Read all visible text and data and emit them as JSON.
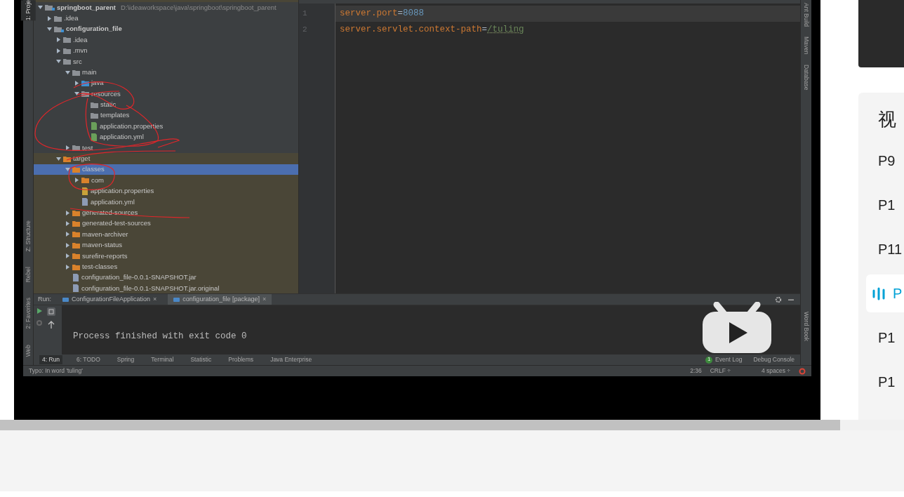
{
  "ide": {
    "left_tools": [
      {
        "label": "1: Proje",
        "selected": true
      },
      {
        "label": "Z: Structure",
        "selected": false
      },
      {
        "label": "Rebel",
        "selected": false
      },
      {
        "label": "2: Favorites",
        "selected": false
      },
      {
        "label": "Web",
        "selected": false
      }
    ],
    "right_tools": [
      {
        "label": "Ant Build"
      },
      {
        "label": "Maven"
      },
      {
        "label": "Database"
      }
    ],
    "right_tools_bottom": [
      {
        "label": "Word Book"
      }
    ],
    "tree": [
      {
        "label": "springboot_parent",
        "hint": "D:\\ideaworkspace\\java\\springboot\\springboot_parent",
        "kind": "folder",
        "module": true,
        "expanded": true,
        "selected": false,
        "color": "#8d9196",
        "children": [
          {
            "label": ".idea",
            "kind": "folder",
            "expanded": false,
            "selected": false,
            "color": "#8d9196"
          },
          {
            "label": "configuration_file",
            "kind": "folder",
            "module": true,
            "expanded": true,
            "selected": false,
            "color": "#8d9196",
            "children": [
              {
                "label": ".idea",
                "kind": "folder",
                "expanded": false,
                "selected": false,
                "color": "#8d9196"
              },
              {
                "label": ".mvn",
                "kind": "folder",
                "expanded": false,
                "selected": false,
                "color": "#8d9196"
              },
              {
                "label": "src",
                "kind": "folder",
                "expanded": true,
                "selected": false,
                "color": "#8d9196",
                "children": [
                  {
                    "label": "main",
                    "kind": "folder",
                    "expanded": true,
                    "selected": false,
                    "color": "#8d9196",
                    "children": [
                      {
                        "label": "java",
                        "kind": "folder",
                        "expanded": false,
                        "selected": false,
                        "color": "#3d8fd1"
                      },
                      {
                        "label": "resources",
                        "kind": "folder",
                        "expanded": true,
                        "selected": false,
                        "color": "#8d9196",
                        "children": [
                          {
                            "label": "static",
                            "kind": "leaf",
                            "selected": false,
                            "color": "#8d9196"
                          },
                          {
                            "label": "templates",
                            "kind": "leaf",
                            "selected": false,
                            "color": "#8d9196"
                          },
                          {
                            "label": "application.properties",
                            "kind": "file",
                            "selected": false,
                            "color": "#6a9f5a"
                          },
                          {
                            "label": "application.yml",
                            "kind": "file",
                            "selected": false,
                            "color": "#6a9f5a"
                          }
                        ]
                      }
                    ]
                  },
                  {
                    "label": "test",
                    "kind": "folder",
                    "expanded": false,
                    "selected": false,
                    "color": "#8d9196"
                  }
                ]
              },
              {
                "label": "target",
                "kind": "folder",
                "expanded": true,
                "selected": false,
                "excluded": true,
                "color": "#d9822b",
                "children": [
                  {
                    "label": "classes",
                    "kind": "folder",
                    "expanded": true,
                    "selected": true,
                    "color": "#d9822b",
                    "children": [
                      {
                        "label": "com",
                        "kind": "folder",
                        "expanded": false,
                        "selected": false,
                        "color": "#d9822b"
                      },
                      {
                        "label": "application.properties",
                        "kind": "file",
                        "selected": false,
                        "color": "#c9a33a"
                      },
                      {
                        "label": "application.yml",
                        "kind": "file",
                        "selected": false,
                        "color": "#8d9bb5"
                      }
                    ]
                  },
                  {
                    "label": "generated-sources",
                    "kind": "folder",
                    "expanded": false,
                    "selected": false,
                    "color": "#d9822b"
                  },
                  {
                    "label": "generated-test-sources",
                    "kind": "folder",
                    "expanded": false,
                    "selected": false,
                    "color": "#d9822b"
                  },
                  {
                    "label": "maven-archiver",
                    "kind": "folder",
                    "expanded": false,
                    "selected": false,
                    "color": "#d9822b"
                  },
                  {
                    "label": "maven-status",
                    "kind": "folder",
                    "expanded": false,
                    "selected": false,
                    "color": "#d9822b"
                  },
                  {
                    "label": "surefire-reports",
                    "kind": "folder",
                    "expanded": false,
                    "selected": false,
                    "color": "#d9822b"
                  },
                  {
                    "label": "test-classes",
                    "kind": "folder",
                    "expanded": false,
                    "selected": false,
                    "color": "#d9822b"
                  },
                  {
                    "label": "configuration_file-0.0.1-SNAPSHOT.jar",
                    "kind": "file",
                    "selected": false,
                    "color": "#8d9bb5"
                  },
                  {
                    "label": "configuration_file-0.0.1-SNAPSHOT.jar.original",
                    "kind": "file",
                    "selected": false,
                    "color": "#8d9bb5"
                  }
                ]
              }
            ]
          }
        ]
      }
    ],
    "editor": {
      "lines": [
        {
          "number": "1",
          "key": "server.port",
          "separator": "=",
          "value": "8088",
          "current": true,
          "typo": false
        },
        {
          "number": "2",
          "key": "server.servlet.context-path",
          "separator": "=",
          "value": "/tuling",
          "current": false,
          "typo": true
        }
      ]
    },
    "run": {
      "label": "Run:",
      "tabs": [
        {
          "label": "ConfigurationFileApplication",
          "close": "×",
          "selected": false
        },
        {
          "label": "configuration_file [package]",
          "close": "×",
          "selected": true
        }
      ],
      "output": "Process finished with exit code 0"
    },
    "tool_tabs": [
      {
        "label": "4: Run",
        "selected": true
      },
      {
        "label": "6: TODO",
        "selected": false
      },
      {
        "label": "Spring",
        "selected": false
      },
      {
        "label": "Terminal",
        "selected": false
      },
      {
        "label": "Statistic",
        "selected": false
      },
      {
        "label": "Problems",
        "selected": false
      },
      {
        "label": "Java Enterprise",
        "selected": false
      }
    ],
    "event_log": {
      "badge": "1",
      "label": "Event Log"
    },
    "debug_console": "Debug Console",
    "status": {
      "message": "Typo: In word 'tuling'",
      "position": "2:36",
      "line_separator": "CRLF ÷",
      "indent": "4 spaces ÷"
    }
  },
  "playlist": {
    "heading": "视",
    "items": [
      {
        "label": "P9",
        "selected": false
      },
      {
        "label": "P1",
        "selected": false
      },
      {
        "label": "P11",
        "selected": false
      },
      {
        "label": "P",
        "selected": true
      },
      {
        "label": "P1",
        "selected": false
      },
      {
        "label": "P1",
        "selected": false
      }
    ]
  }
}
